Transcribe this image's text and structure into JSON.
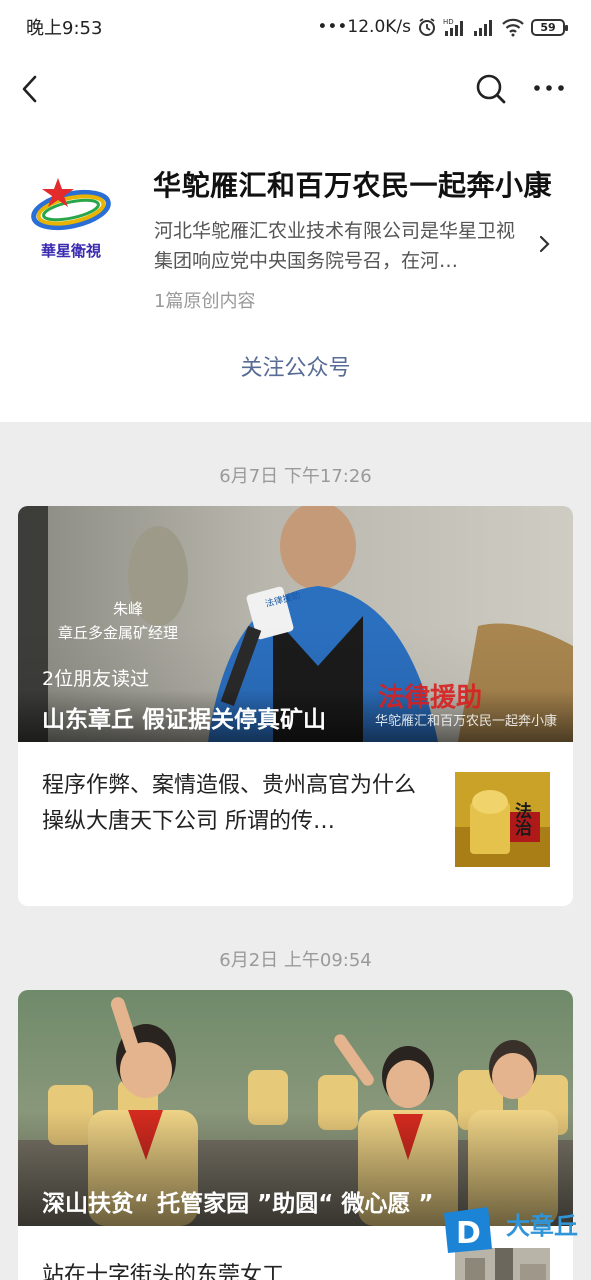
{
  "status_bar": {
    "time": "晚上9:53",
    "speed": "•••12.0K/s",
    "hd_label": "HD",
    "battery": "59"
  },
  "profile": {
    "name": "华鸵雁汇和百万农民一起奔小康",
    "description": "河北华鸵雁汇农业技术有限公司是华星卫视集团响应党中央国务院号召，在河…",
    "original_count": "1篇原创内容",
    "follow_label": "关注公众号",
    "logo_text": "華星衛視"
  },
  "feed": [
    {
      "date": "6月7日  下午17:26",
      "cover_person_name": "朱峰",
      "cover_person_title": "章丘多金属矿经理",
      "friends_read": "2位朋友读过",
      "cover_title": "山东章丘 假证据关停真矿山",
      "cover_watermark": "华鸵雁汇和百万农民一起奔小康",
      "cover_stamp_text": "法律援助",
      "mic_label": "法律援助",
      "sub_article": "程序作弊、案情造假、贵州高官为什么操纵大唐天下公司 所谓的传…",
      "thumb_text": "法治"
    },
    {
      "date": "6月2日  上午09:54",
      "cover_title": "深山扶贫“ 托管家园 ”助圆“ 微心愿 ”",
      "sub_article": "站在十字街头的东莞女工"
    }
  ],
  "brand": {
    "letter": "D",
    "name": "大章丘"
  },
  "colors": {
    "link": "#576b95",
    "background": "#ededed",
    "brand_blue": "#2f95d8"
  }
}
